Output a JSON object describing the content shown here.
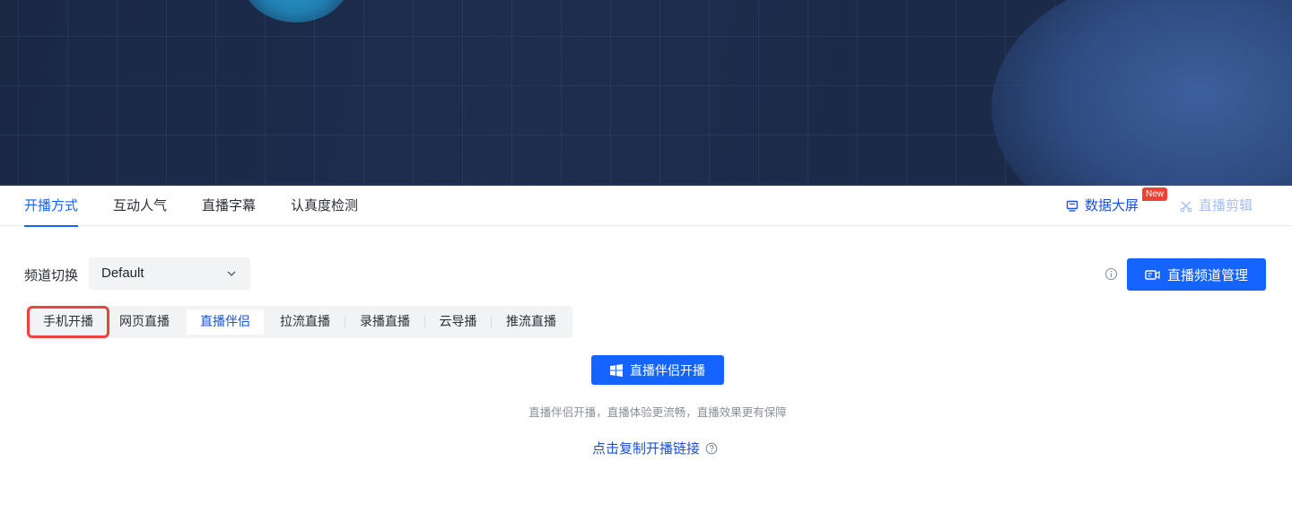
{
  "tabs": [
    {
      "label": "开播方式",
      "active": true
    },
    {
      "label": "互动人气",
      "active": false
    },
    {
      "label": "直播字幕",
      "active": false
    },
    {
      "label": "认真度检测",
      "active": false
    }
  ],
  "tabs_right": {
    "data_screen": {
      "label": "数据大屏",
      "icon": "monitor-icon",
      "badge": "New"
    },
    "live_clip": {
      "label": "直播剪辑",
      "icon": "scissors-icon",
      "disabled": true
    }
  },
  "channel": {
    "label": "频道切换",
    "selected": "Default",
    "manage_button": "直播频道管理"
  },
  "modes": [
    {
      "label": "手机开播",
      "highlighted": true
    },
    {
      "label": "网页直播"
    },
    {
      "label": "直播伴侣",
      "selected": true
    },
    {
      "label": "拉流直播"
    },
    {
      "label": "录播直播"
    },
    {
      "label": "云导播"
    },
    {
      "label": "推流直播"
    }
  ],
  "companion": {
    "start_button": "直播伴侣开播",
    "hint": "直播伴侣开播，直播体验更流畅，直播效果更有保障",
    "copy_link": "点击复制开播链接"
  },
  "colors": {
    "accent": "#1664ff",
    "link": "#1e50d6",
    "badge": "#f04134",
    "highlight": "#e8453c",
    "banner": "#1d2d4f"
  }
}
